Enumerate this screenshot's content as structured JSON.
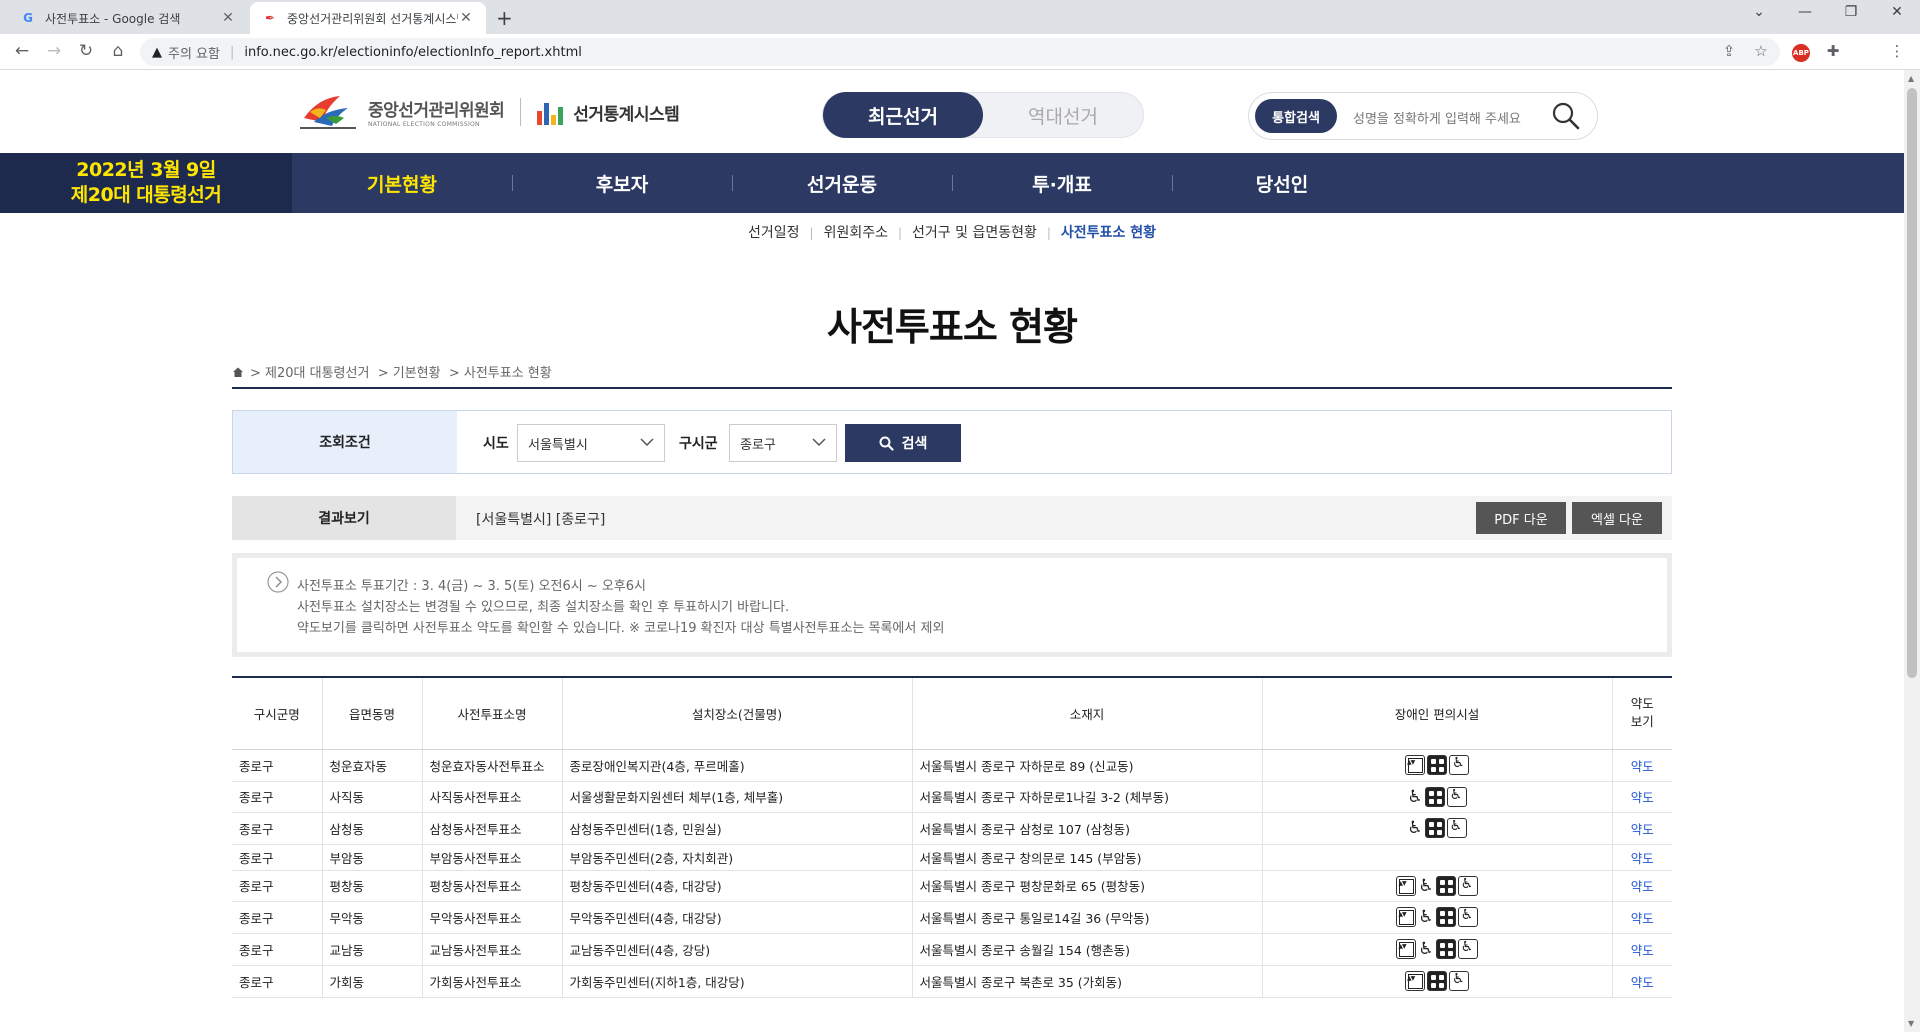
{
  "browser": {
    "tabs": [
      {
        "favicon": "G",
        "title": "사전투표소 - Google 검색"
      },
      {
        "favicon": "✒",
        "title": "중앙선거관리위원회 선거통계시스템"
      }
    ],
    "security_label": "주의 요함",
    "url": "info.nec.go.kr/electioninfo/electionInfo_report.xhtml",
    "abp_label": "ABP"
  },
  "header": {
    "org_name": "중앙선거관리위원회",
    "org_name_en": "NATIONAL ELECTION COMMISSION",
    "system_name": "선거통계시스템",
    "toggle": {
      "recent": "최근선거",
      "past": "역대선거"
    },
    "search": {
      "label": "통합검색",
      "placeholder": "성명을 정확하게 입력해 주세요"
    }
  },
  "election_badge": {
    "line1": "2022년 3월 9일",
    "line2": "제20대 대통령선거"
  },
  "main_nav": [
    "기본현황",
    "후보자",
    "선거운동",
    "투·개표",
    "당선인"
  ],
  "sub_nav": [
    "선거일정",
    "위원회주소",
    "선거구 및 읍면동현황",
    "사전투표소 현황"
  ],
  "page_title": "사전투표소 현황",
  "breadcrumb": [
    "> 제20대 대통령선거",
    "> 기본현황",
    "> 사전투표소 현황"
  ],
  "search_form": {
    "header": "조회조건",
    "sido_label": "시도",
    "sido_value": "서울특별시",
    "gusigun_label": "구시군",
    "gusigun_value": "종로구",
    "search_button": "검색"
  },
  "result_bar": {
    "header": "결과보기",
    "text": "[서울특별시] [종로구]",
    "pdf_button": "PDF 다운",
    "excel_button": "엑셀 다운"
  },
  "notice": [
    "사전투표소 투표기간 : 3. 4(금) ~ 3. 5(토) 오전6시 ~ 오후6시",
    "사전투표소 설치장소는 변경될 수 있으므로, 최종 설치장소를 확인 후 투표하시기 바랍니다.",
    "약도보기를 클릭하면 사전투표소 약도를 확인할 수 있습니다. ※ 코로나19 확진자 대상 특별사전투표소는 목록에서 제외"
  ],
  "table": {
    "headers": [
      "구시군명",
      "읍면동명",
      "사전투표소명",
      "설치장소(건물명)",
      "소재지",
      "장애인 편의시설",
      "약도\n보기"
    ],
    "rows": [
      {
        "gu": "종로구",
        "dong": "청운효자동",
        "name": "청운효자동사전투표소",
        "place": "종로장애인복지관(4층, 푸르메홀)",
        "addr": "서울특별시 종로구 자하문로 89 (신교동)",
        "fac": [
          "elevator",
          "ramp",
          "wheelchair"
        ],
        "map": "약도"
      },
      {
        "gu": "종로구",
        "dong": "사직동",
        "name": "사직동사전투표소",
        "place": "서울생활문화지원센터 체부(1층, 체부홀)",
        "addr": "서울특별시 종로구 자하문로1나길 3-2 (체부동)",
        "fac": [
          "wheelchair-plain",
          "ramp",
          "wheelchair"
        ],
        "map": "약도"
      },
      {
        "gu": "종로구",
        "dong": "삼청동",
        "name": "삼청동사전투표소",
        "place": "삼청동주민센터(1층, 민원실)",
        "addr": "서울특별시 종로구 삼청로 107 (삼청동)",
        "fac": [
          "wheelchair-plain",
          "ramp",
          "wheelchair"
        ],
        "map": "약도"
      },
      {
        "gu": "종로구",
        "dong": "부암동",
        "name": "부암동사전투표소",
        "place": "부암동주민센터(2층, 자치회관)",
        "addr": "서울특별시 종로구 창의문로 145 (부암동)",
        "fac": [],
        "map": "약도"
      },
      {
        "gu": "종로구",
        "dong": "평창동",
        "name": "평창동사전투표소",
        "place": "평창동주민센터(4층, 대강당)",
        "addr": "서울특별시 종로구 평창문화로 65 (평창동)",
        "fac": [
          "elevator",
          "wheelchair-plain",
          "ramp",
          "wheelchair"
        ],
        "map": "약도"
      },
      {
        "gu": "종로구",
        "dong": "무악동",
        "name": "무악동사전투표소",
        "place": "무악동주민센터(4층, 대강당)",
        "addr": "서울특별시 종로구 통일로14길 36 (무악동)",
        "fac": [
          "elevator",
          "wheelchair-plain",
          "ramp",
          "wheelchair"
        ],
        "map": "약도"
      },
      {
        "gu": "종로구",
        "dong": "교남동",
        "name": "교남동사전투표소",
        "place": "교남동주민센터(4층, 강당)",
        "addr": "서울특별시 종로구 송월길 154 (행촌동)",
        "fac": [
          "elevator",
          "wheelchair-plain",
          "ramp",
          "wheelchair"
        ],
        "map": "약도"
      },
      {
        "gu": "종로구",
        "dong": "가회동",
        "name": "가회동사전투표소",
        "place": "가회동주민센터(지하1층, 대강당)",
        "addr": "서울특별시 종로구 북촌로 35 (가회동)",
        "fac": [
          "elevator",
          "ramp",
          "wheelchair"
        ],
        "map": "약도"
      }
    ]
  }
}
